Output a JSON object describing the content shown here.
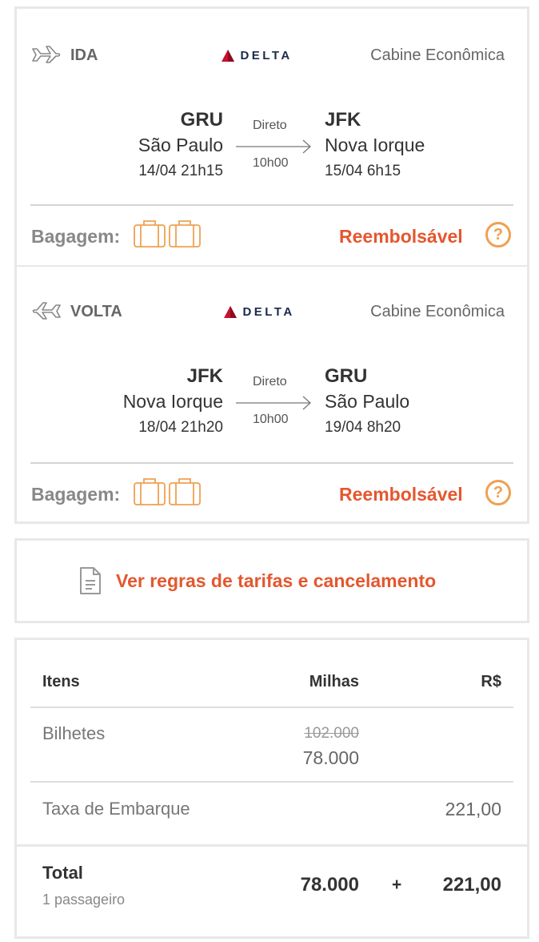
{
  "outbound": {
    "direction": "IDA",
    "airline": "DELTA",
    "cabin": "Cabine Econômica",
    "origin_code": "GRU",
    "origin_city": "São Paulo",
    "departure": "14/04 21h15",
    "stops": "Direto",
    "duration": "10h00",
    "dest_code": "JFK",
    "dest_city": "Nova Iorque",
    "arrival": "15/04 6h15",
    "baggage_label": "Bagagem:",
    "refundable": "Reembolsável",
    "help": "?"
  },
  "return": {
    "direction": "VOLTA",
    "airline": "DELTA",
    "cabin": "Cabine Econômica",
    "origin_code": "JFK",
    "origin_city": "Nova Iorque",
    "departure": "18/04 21h20",
    "stops": "Direto",
    "duration": "10h00",
    "dest_code": "GRU",
    "dest_city": "São Paulo",
    "arrival": "19/04 8h20",
    "baggage_label": "Bagagem:",
    "refundable": "Reembolsável",
    "help": "?"
  },
  "rules": {
    "link": "Ver regras de tarifas e cancelamento"
  },
  "summary": {
    "col_items": "Itens",
    "col_miles": "Milhas",
    "col_brl": "R$",
    "tickets_label": "Bilhetes",
    "tickets_old_miles": "102.000",
    "tickets_miles": "78.000",
    "tax_label": "Taxa de Embarque",
    "tax_brl": "221,00",
    "total_label": "Total",
    "passengers": "1 passageiro",
    "total_miles": "78.000",
    "plus": "+",
    "total_brl": "221,00"
  },
  "colors": {
    "accent": "#e4572e",
    "baggage": "#f0a050",
    "delta_red": "#c8102e",
    "delta_navy": "#1b2a4a"
  }
}
